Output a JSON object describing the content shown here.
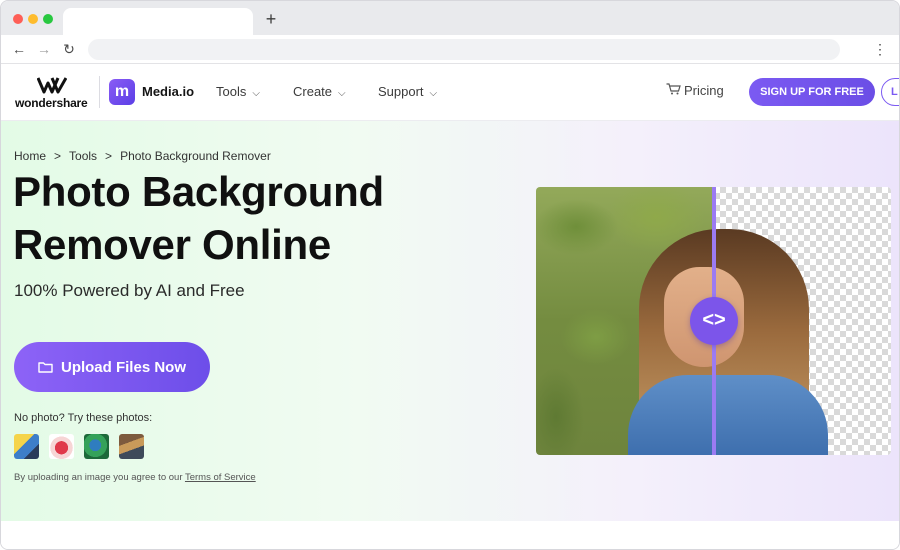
{
  "browser": {
    "new_tab_label": "+",
    "back_label": "←",
    "forward_label": "→",
    "reload_label": "↻",
    "url": "",
    "menu_label": "⋮"
  },
  "header": {
    "brand_name": "wondershare",
    "product_name": "Media.io",
    "product_icon_letter": "m",
    "nav": [
      {
        "label": "Tools"
      },
      {
        "label": "Create"
      },
      {
        "label": "Support"
      }
    ],
    "pricing_label": "Pricing",
    "signup_label": "SIGN UP FOR FREE",
    "login_label": "L"
  },
  "hero": {
    "breadcrumb": [
      "Home",
      "Tools",
      "Photo Background Remover"
    ],
    "breadcrumb_sep": ">",
    "title": "Photo Background Remover Online",
    "subtitle": "100% Powered by AI and Free",
    "upload_label": "Upload Files Now",
    "no_photo_text": "No photo? Try these photos:",
    "terms_prefix": "By uploading an image you agree to our",
    "terms_link": "Terms of Service",
    "compare_handle_label": "<>"
  },
  "colors": {
    "accent": "#7b5af2",
    "hero_green": "#e3fbe6",
    "hero_purple": "#ece4fb"
  }
}
